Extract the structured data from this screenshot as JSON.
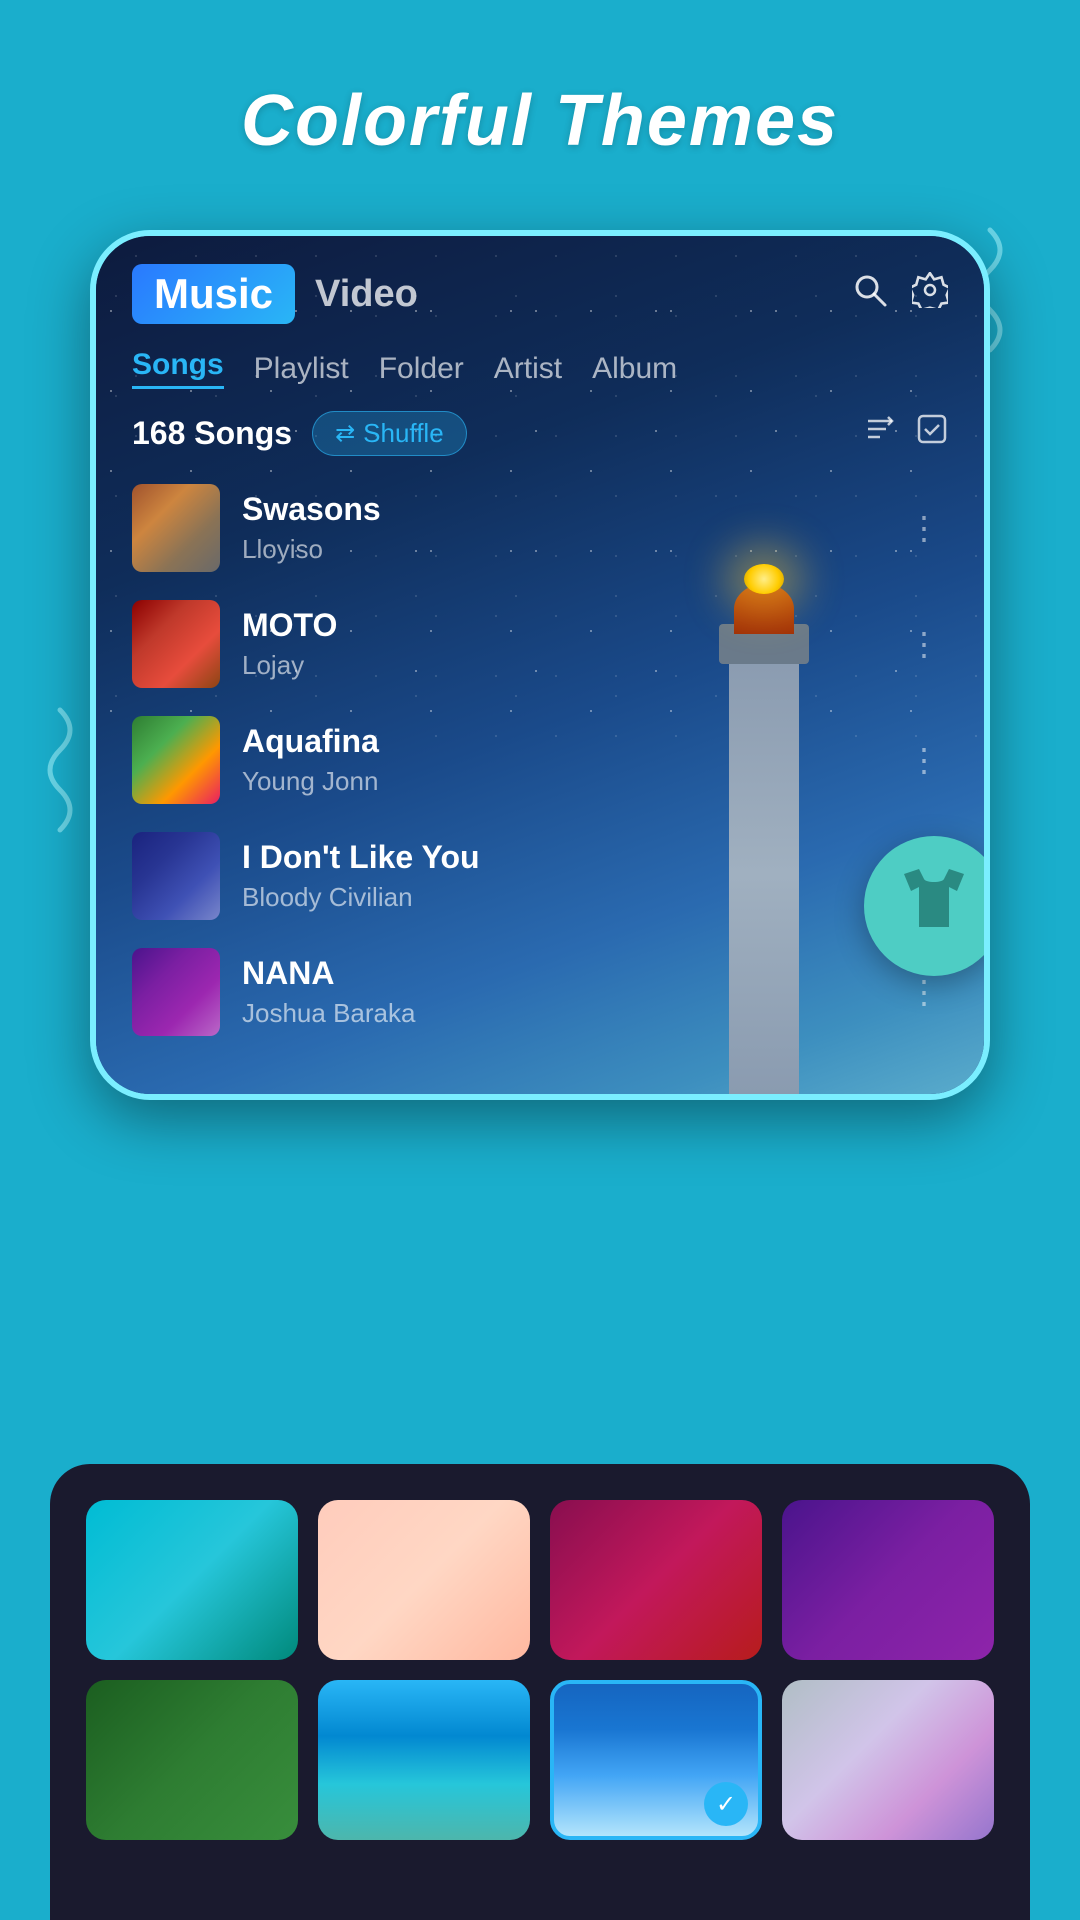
{
  "page": {
    "title": "Colorful Themes",
    "bg_color": "#1aaecc"
  },
  "nav": {
    "tab_music": "Music",
    "tab_video": "Video",
    "search_icon": "search-icon",
    "settings_icon": "settings-icon"
  },
  "sub_tabs": [
    {
      "label": "Songs",
      "active": true
    },
    {
      "label": "Playlist",
      "active": false
    },
    {
      "label": "Folder",
      "active": false
    },
    {
      "label": "Artist",
      "active": false
    },
    {
      "label": "Album",
      "active": false
    }
  ],
  "songs_bar": {
    "count": "168 Songs",
    "shuffle_label": "Shuffle"
  },
  "songs": [
    {
      "title": "Swasons",
      "artist": "Lloyiso",
      "thumb_class": "thumb-1"
    },
    {
      "title": "MOTO",
      "artist": "Lojay",
      "thumb_class": "thumb-2"
    },
    {
      "title": "Aquafina",
      "artist": "Young Jonn",
      "thumb_class": "thumb-3"
    },
    {
      "title": "I Don't Like You",
      "artist": "Bloody Civilian",
      "thumb_class": "thumb-4"
    },
    {
      "title": "NANA",
      "artist": "Joshua Baraka",
      "thumb_class": "thumb-5"
    }
  ],
  "themes": [
    {
      "id": "teal",
      "class": "swatch-teal",
      "selected": false
    },
    {
      "id": "peach",
      "class": "swatch-peach",
      "selected": false
    },
    {
      "id": "crimson",
      "class": "swatch-crimson",
      "selected": false
    },
    {
      "id": "purple",
      "class": "swatch-purple",
      "selected": false
    },
    {
      "id": "green",
      "class": "swatch-green",
      "selected": false
    },
    {
      "id": "beach",
      "class": "swatch-beach",
      "selected": false
    },
    {
      "id": "lighthouse",
      "class": "swatch-lighthouse",
      "selected": true
    },
    {
      "id": "lavender",
      "class": "swatch-lavender",
      "selected": false
    }
  ]
}
